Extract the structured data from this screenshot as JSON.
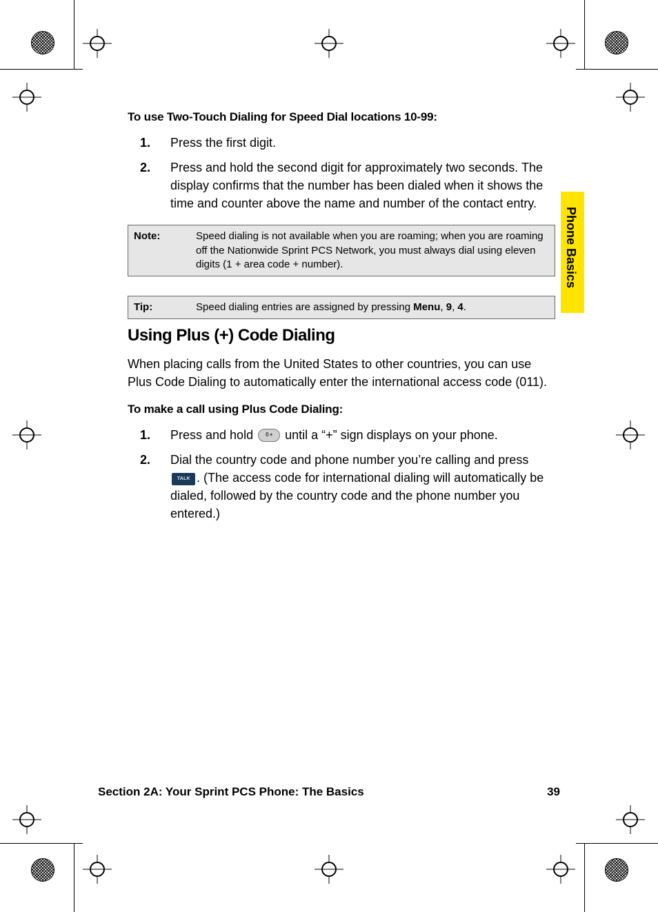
{
  "speed_dial": {
    "subhead": "To use Two-Touch Dialing for Speed Dial locations 10-99:",
    "steps": [
      {
        "num": "1.",
        "text": "Press the first digit."
      },
      {
        "num": "2.",
        "text": "Press and hold the second digit for approximately two seconds. The display confirms that the number has been dialed when it shows the time and counter above the name and number of the contact entry."
      }
    ]
  },
  "note": {
    "label": "Note:",
    "text": "Speed dialing is not available when you are roaming; when you are roaming off the Nationwide Sprint PCS Network, you must always dial using eleven digits (1 + area code + number)."
  },
  "tip": {
    "label": "Tip:",
    "prefix": "Speed dialing entries are assigned by pressing ",
    "menu_bold": "Menu",
    "sep1": ", ",
    "nine_bold": "9",
    "sep2": ", ",
    "four_bold": "4",
    "suffix": "."
  },
  "plus_code": {
    "heading": "Using Plus (+) Code Dialing",
    "intro": "When placing calls from the United States to other countries, you can use Plus Code Dialing to automatically enter the international access code (011).",
    "subhead": "To make a call using Plus Code Dialing:",
    "steps": [
      {
        "num": "1.",
        "pre": "Press and hold ",
        "post": " until a “+” sign displays on your phone."
      },
      {
        "num": "2.",
        "pre": "Dial the country code and phone number you’re calling and press ",
        "post": ". (The access code for international dialing will automatically be dialed, followed by the country code and the phone number you entered.)"
      }
    ]
  },
  "side_tab": "Phone Basics",
  "footer": {
    "section": "Section 2A: Your Sprint PCS Phone: The Basics",
    "page": "39"
  }
}
